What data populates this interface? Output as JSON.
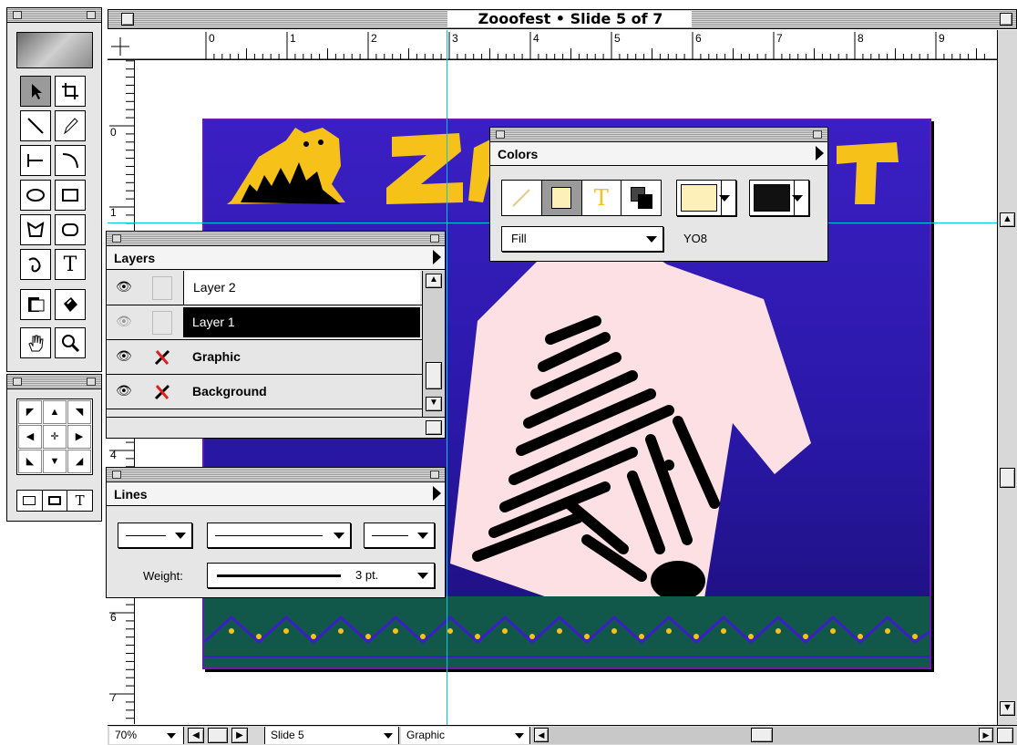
{
  "window": {
    "title": "Zooofest • Slide 5 of 7"
  },
  "ruler": {
    "top_labels": [
      "0",
      "1",
      "2",
      "3",
      "4",
      "5",
      "6",
      "7",
      "8",
      "9"
    ],
    "left_labels": [
      "0",
      "1",
      "4",
      "6",
      "7"
    ]
  },
  "toolbox": {
    "tools": [
      "pointer-tool",
      "crop-tool",
      "line-tool",
      "pencil-tool",
      "connector-tool",
      "arc-tool",
      "ellipse-tool",
      "rectangle-tool",
      "polygon-tool",
      "rounded-rect-tool",
      "freeform-tool",
      "text-tool",
      "link-tool",
      "paint-bucket-tool",
      "hand-tool",
      "zoom-tool"
    ],
    "selected": "pointer-tool",
    "text_glyph": "T"
  },
  "colors_palette": {
    "title": "Colors",
    "fill_dropdown": "Fill",
    "color_code": "YO8",
    "fill_color": "#fdf0b8",
    "line_color": "#111111"
  },
  "layers_palette": {
    "title": "Layers",
    "layers": [
      {
        "name": "Layer 2",
        "visible": true,
        "locked": false,
        "selected": false
      },
      {
        "name": "Layer 1",
        "visible": false,
        "locked": false,
        "selected": true
      },
      {
        "name": "Graphic",
        "visible": true,
        "locked": true,
        "selected": false
      },
      {
        "name": "Background",
        "visible": true,
        "locked": true,
        "selected": false
      }
    ]
  },
  "lines_palette": {
    "title": "Lines",
    "weight_label": "Weight:",
    "weight_value": "3 pt."
  },
  "status_bar": {
    "zoom": "70%",
    "slide": "Slide 5",
    "layer": "Graphic"
  },
  "colors": {
    "slide_bg_top": "#3b1fc4",
    "slide_bg_bottom": "#1c0f7a",
    "title_yellow": "#f6c21a",
    "border_green": "#12584a",
    "shirt": "#fde0e4",
    "guide": "#00c8e0"
  }
}
